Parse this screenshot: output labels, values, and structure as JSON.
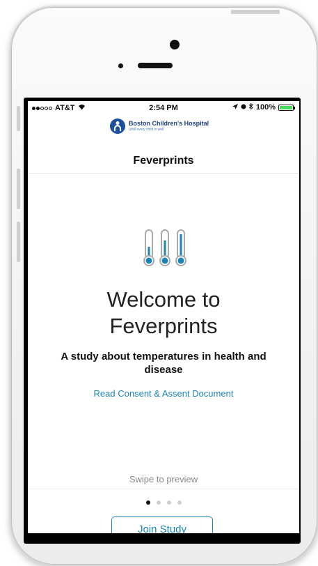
{
  "status_bar": {
    "carrier": "AT&T",
    "time": "2:54 PM",
    "battery": "100%",
    "signal_dots": [
      true,
      true,
      false,
      false,
      false
    ]
  },
  "logo": {
    "name": "Boston Children's Hospital",
    "tagline": "Until every child is well"
  },
  "nav": {
    "title": "Feverprints"
  },
  "welcome": {
    "line1": "Welcome to",
    "line2": "Feverprints",
    "subtitle": "A study about temperatures in health and disease",
    "consent_link": "Read Consent & Assent Document"
  },
  "footer": {
    "swipe_hint": "Swipe to preview",
    "page_count": 4,
    "current_page": 1,
    "join_label": "Join Study"
  },
  "colors": {
    "accent": "#1b84b8",
    "thermometer_fill": "#1b84b8",
    "battery": "#4cd964",
    "logo_blue": "#1c4f9c"
  },
  "icons": [
    "wifi-icon",
    "location-icon",
    "alarm-icon",
    "bluetooth-icon",
    "battery-icon",
    "thermometer-icon"
  ]
}
